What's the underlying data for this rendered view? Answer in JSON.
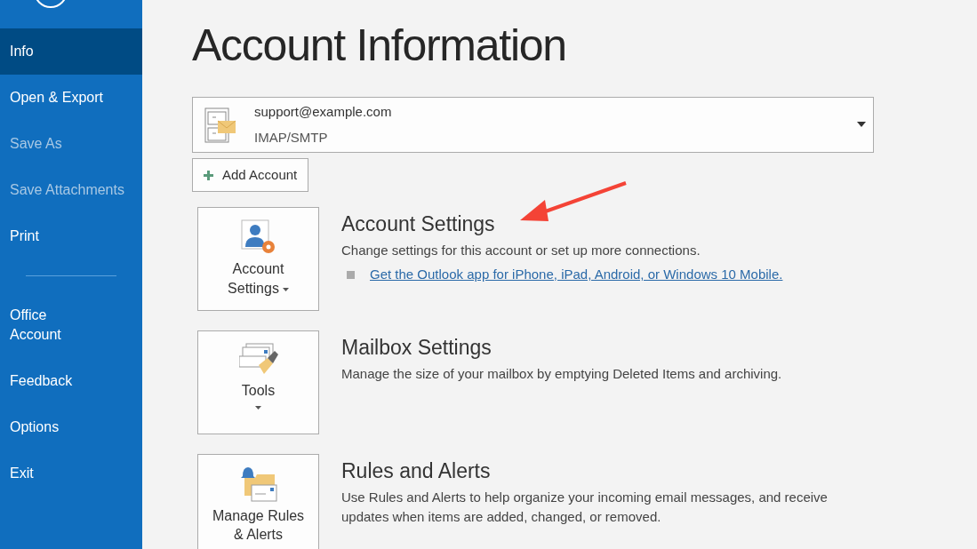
{
  "sidebar": {
    "items": [
      {
        "kind": "item",
        "label": "Info",
        "selected": true,
        "disabled": false
      },
      {
        "kind": "item",
        "label": "Open & Export",
        "selected": false,
        "disabled": false
      },
      {
        "kind": "item",
        "label": "Save As",
        "selected": false,
        "disabled": true
      },
      {
        "kind": "item",
        "label": "Save Attachments",
        "selected": false,
        "disabled": true
      },
      {
        "kind": "item",
        "label": "Print",
        "selected": false,
        "disabled": false
      },
      {
        "kind": "divider"
      },
      {
        "kind": "item",
        "label": "Office\nAccount",
        "selected": false,
        "disabled": false
      },
      {
        "kind": "item",
        "label": "Feedback",
        "selected": false,
        "disabled": false
      },
      {
        "kind": "item",
        "label": "Options",
        "selected": false,
        "disabled": false
      },
      {
        "kind": "item",
        "label": "Exit",
        "selected": false,
        "disabled": false
      }
    ]
  },
  "page_title": "Account Information",
  "account": {
    "email": "support@example.com",
    "type": "IMAP/SMTP"
  },
  "add_account_button": "Add Account",
  "sections": [
    {
      "kind": "account",
      "button": "Account\nSettings",
      "title": "Account Settings",
      "description": "Change settings for this account or set up more connections.",
      "links": [
        "Get the Outlook app for iPhone, iPad, Android, or Windows 10 Mobile."
      ]
    },
    {
      "kind": "tools",
      "button": "Tools",
      "title": "Mailbox Settings",
      "description": "Manage the size of your mailbox by emptying Deleted Items and archiving."
    },
    {
      "kind": "rules",
      "button": "Manage Rules\n& Alerts",
      "title": "Rules and Alerts",
      "description": "Use Rules and Alerts to help organize your incoming email messages, and receive updates when items are added, changed, or removed."
    }
  ]
}
